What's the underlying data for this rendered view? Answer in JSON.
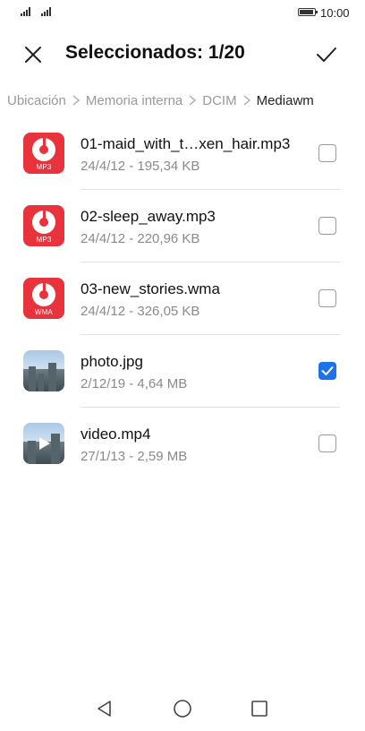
{
  "status_bar": {
    "time": "10:00"
  },
  "header": {
    "title": "Seleccionados: 1/20"
  },
  "breadcrumb": [
    "Ubicación",
    "Memoria interna",
    "DCIM",
    "Mediawm"
  ],
  "files": [
    {
      "name": "01-maid_with_t…xen_hair.mp3",
      "meta": "24/4/12 - 195,34 KB",
      "type": "audio",
      "format": "MP3",
      "checked": false
    },
    {
      "name": "02-sleep_away.mp3",
      "meta": "24/4/12 - 220,96 KB",
      "type": "audio",
      "format": "MP3",
      "checked": false
    },
    {
      "name": "03-new_stories.wma",
      "meta": "24/4/12 - 326,05 KB",
      "type": "audio",
      "format": "WMA",
      "checked": false
    },
    {
      "name": "photo.jpg",
      "meta": "2/12/19 - 4,64 MB",
      "type": "image",
      "format": "",
      "checked": true
    },
    {
      "name": "video.mp4",
      "meta": "27/1/13 - 2,59 MB",
      "type": "video",
      "format": "",
      "checked": false
    }
  ],
  "colors": {
    "accent": "#1a73e8",
    "audio_icon": "#e8323c"
  }
}
